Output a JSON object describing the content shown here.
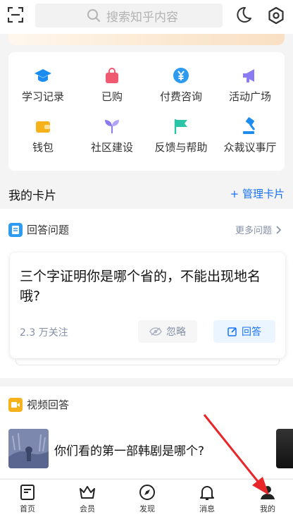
{
  "header": {
    "search_placeholder": "搜索知乎内容"
  },
  "services": [
    {
      "label": "学习记录",
      "icon": "graduation-cap-icon",
      "color": "#1c8cf0"
    },
    {
      "label": "已购",
      "icon": "shopping-bag-icon",
      "color": "#ef5a70"
    },
    {
      "label": "付费咨询",
      "icon": "yen-coin-icon",
      "color": "#2d9cf0"
    },
    {
      "label": "活动广场",
      "icon": "megaphone-icon",
      "color": "#8a7cf0"
    },
    {
      "label": "钱包",
      "icon": "wallet-icon",
      "color": "#f6b21a"
    },
    {
      "label": "社区建设",
      "icon": "sprout-icon",
      "color": "#8a7cf0"
    },
    {
      "label": "反馈与帮助",
      "icon": "flag-icon",
      "color": "#2cc4a6"
    },
    {
      "label": "众裁议事厅",
      "icon": "gavel-icon",
      "color": "#1c8cf0"
    }
  ],
  "my_cards": {
    "title": "我的卡片",
    "manage_label": "+ 管理卡片"
  },
  "answer_card": {
    "section_title": "回答问题",
    "more_label": "更多问题",
    "question": "三个字证明你是哪个省的，不能出现地名哦?",
    "followers": "2.3 万关注",
    "ignore_label": "忽略",
    "answer_label": "回答"
  },
  "video_card": {
    "section_title": "视频回答",
    "question": "你们看的第一部韩剧是哪个?"
  },
  "tabbar": {
    "items": [
      {
        "label": "首页",
        "icon": "home-icon"
      },
      {
        "label": "会员",
        "icon": "crown-icon"
      },
      {
        "label": "发现",
        "icon": "compass-icon"
      },
      {
        "label": "消息",
        "icon": "bell-icon"
      },
      {
        "label": "我的",
        "icon": "profile-icon"
      }
    ]
  },
  "annotation": {
    "arrow_color": "#e8262a"
  }
}
